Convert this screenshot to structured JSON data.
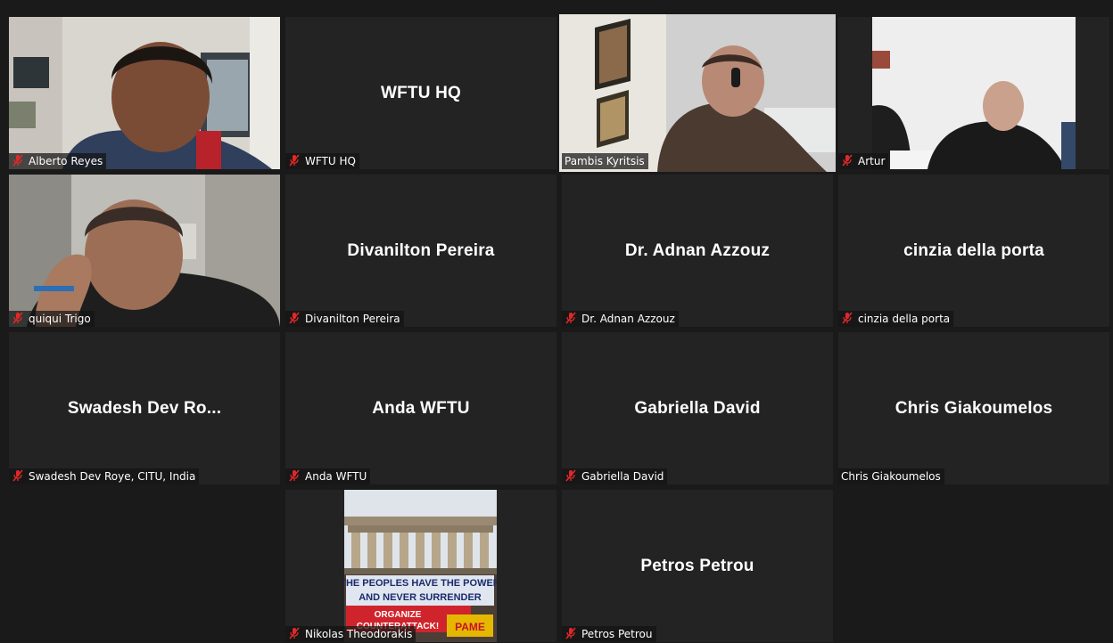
{
  "participants": [
    {
      "name": "Alberto Reyes",
      "display": "",
      "muted": true,
      "video": true
    },
    {
      "name": "WFTU HQ",
      "display": "WFTU HQ",
      "muted": true,
      "video": false
    },
    {
      "name": "Pambis Kyritsis",
      "display": "",
      "muted": false,
      "video": true,
      "speaking": true
    },
    {
      "name": "Artur",
      "display": "",
      "muted": true,
      "video": true
    },
    {
      "name": "quiqui Trigo",
      "display": "",
      "muted": true,
      "video": true
    },
    {
      "name": "Divanilton Pereira",
      "display": "Divanilton Pereira",
      "muted": true,
      "video": false
    },
    {
      "name": "Dr. Adnan Azzouz",
      "display": "Dr. Adnan Azzouz",
      "muted": true,
      "video": false
    },
    {
      "name": "cinzia della porta",
      "display": "cinzia della porta",
      "muted": true,
      "video": false
    },
    {
      "name": "Swadesh Dev Roye, CITU, India",
      "display": "Swadesh Dev Ro...",
      "muted": true,
      "video": false
    },
    {
      "name": "Anda WFTU",
      "display": "Anda WFTU",
      "muted": true,
      "video": false
    },
    {
      "name": "Gabriella David",
      "display": "Gabriella David",
      "muted": true,
      "video": false
    },
    {
      "name": "Chris Giakoumelos",
      "display": "Chris Giakoumelos",
      "muted": false,
      "video": false
    },
    {
      "name": "Nikolas Theodorakis",
      "display": "",
      "muted": true,
      "video": false,
      "avatar": true
    },
    {
      "name": "Petros Petrou",
      "display": "Petros Petrou",
      "muted": true,
      "video": false
    }
  ],
  "banner": {
    "line1": "THE PEOPLES HAVE THE POWER",
    "line2": "AND NEVER SURRENDER",
    "line3": "ORGANIZE",
    "line4": "COUNTERATTACK!",
    "logo": "PAME"
  },
  "colors": {
    "background": "#1a1a1a",
    "tile": "#232323",
    "speaker_border": "#d7ec7b",
    "muted_icon": "#e02828"
  },
  "icons": {
    "muted": "muted-microphone-icon"
  }
}
